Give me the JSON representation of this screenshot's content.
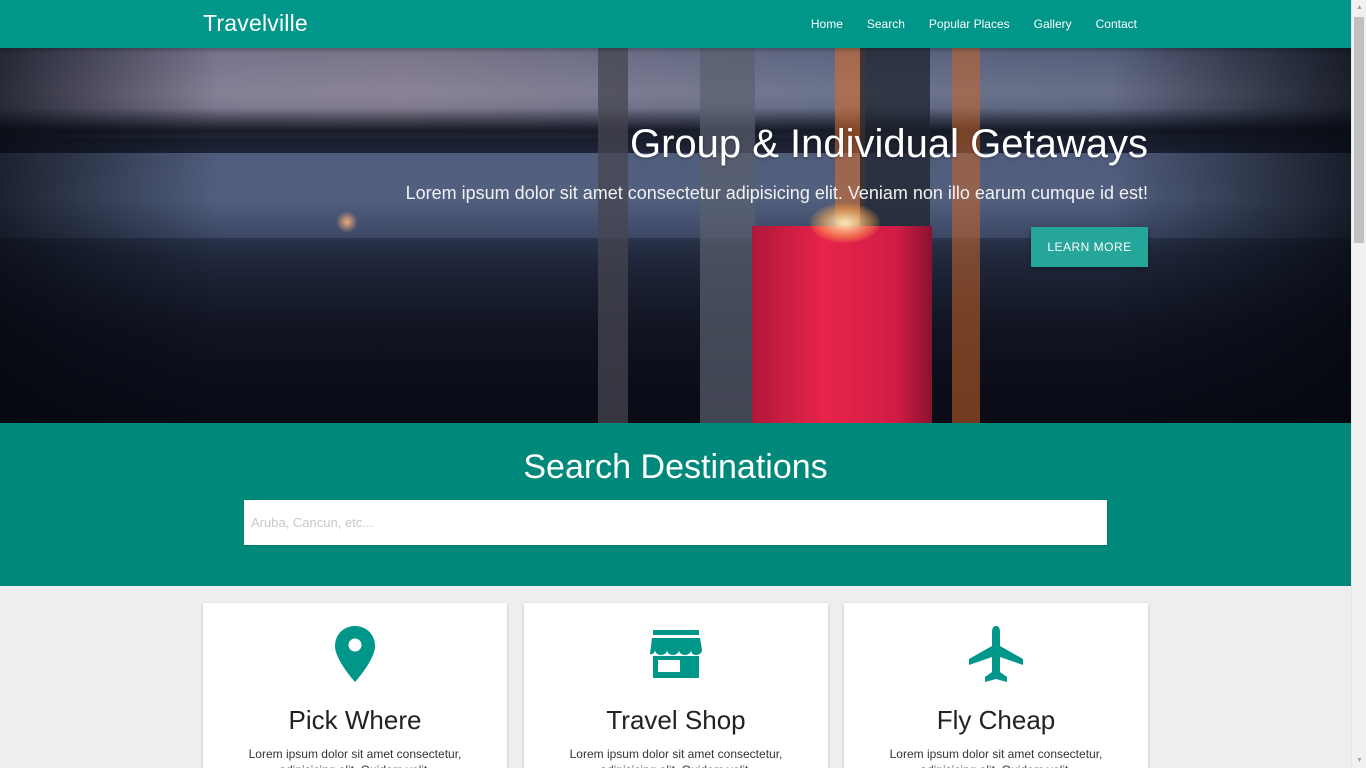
{
  "nav": {
    "brand": "Travelville",
    "links": [
      "Home",
      "Search",
      "Popular Places",
      "Gallery",
      "Contact"
    ]
  },
  "hero": {
    "title": "Group & Individual Getaways",
    "subtitle": "Lorem ipsum dolor sit amet consectetur adipisicing elit. Veniam non illo earum cumque id est!",
    "button_label": "LEARN MORE"
  },
  "search": {
    "title": "Search Destinations",
    "placeholder": "Aruba, Cancun, etc..."
  },
  "cards": [
    {
      "icon": "map-pin-icon",
      "title": "Pick Where",
      "text": "Lorem ipsum dolor sit amet consectetur, adipisicing elit. Quidem velit."
    },
    {
      "icon": "store-icon",
      "title": "Travel Shop",
      "text": "Lorem ipsum dolor sit amet consectetur, adipisicing elit. Quidem velit."
    },
    {
      "icon": "airplane-icon",
      "title": "Fly Cheap",
      "text": "Lorem ipsum dolor sit amet consectetur, adipisicing elit. Quidem velit."
    }
  ],
  "colors": {
    "primary": "#00968a",
    "section": "#00897b",
    "accent": "#26a69a",
    "icon": "#00968a"
  }
}
